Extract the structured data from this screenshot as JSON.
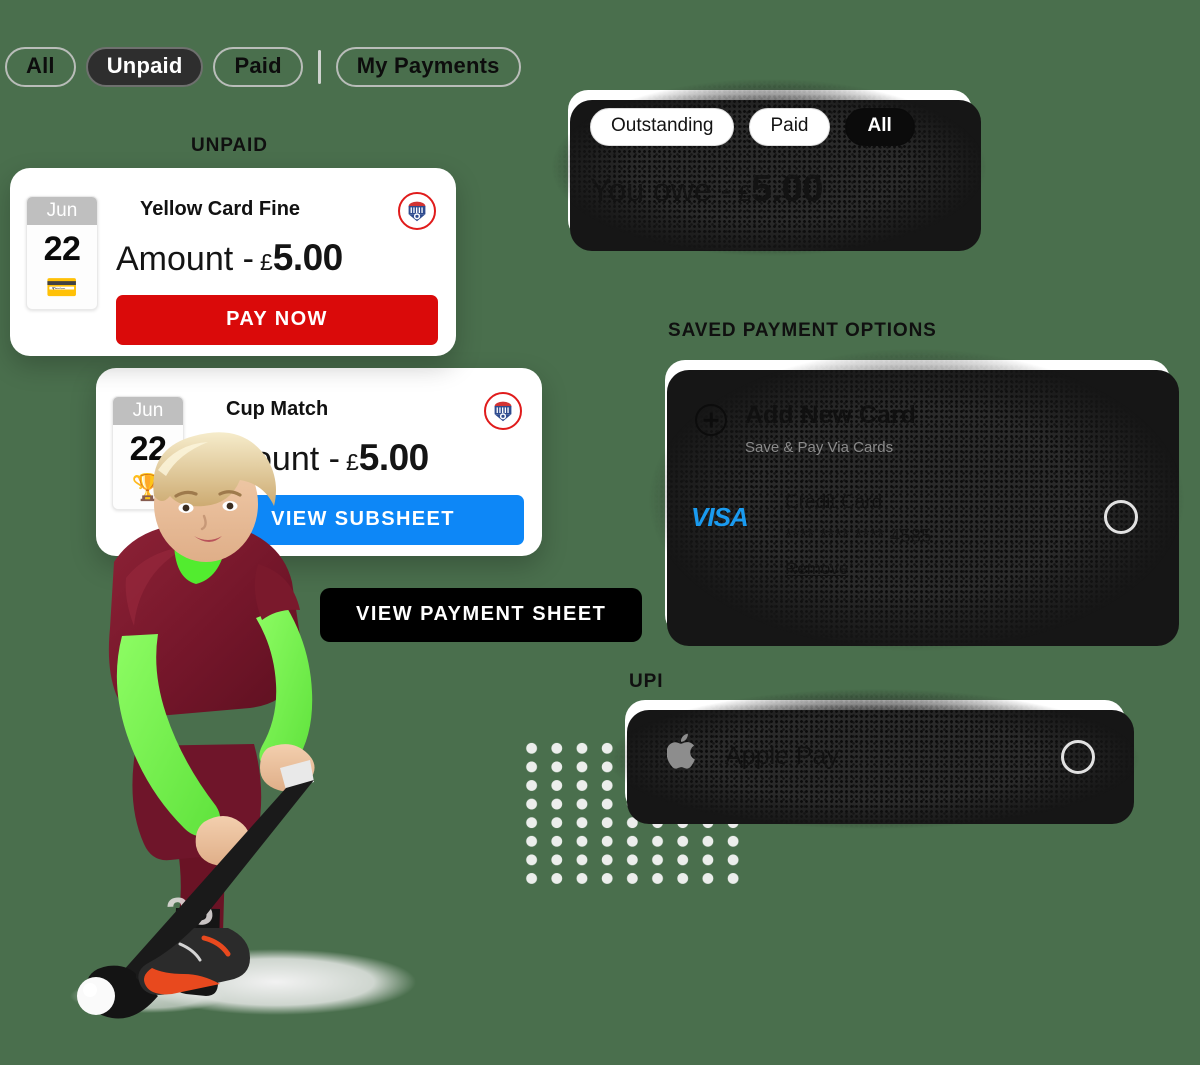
{
  "theme": {
    "background": "#4a6f4d",
    "accent_red": "#da0a0a",
    "accent_blue": "#0d87f7",
    "visa_blue": "#1a9bf0",
    "dark": "#0b0b0b"
  },
  "filter_bar": {
    "items": [
      {
        "label": "All",
        "active": false
      },
      {
        "label": "Unpaid",
        "active": true
      },
      {
        "label": "Paid",
        "active": false
      },
      {
        "label": "My Payments",
        "active": false
      }
    ]
  },
  "unpaid_section": {
    "heading": "UNPAID",
    "cards": [
      {
        "title": "Yellow Card Fine",
        "month": "Jun",
        "day": "22",
        "emoji": "credit-card-emoji",
        "emoji_glyph": "💳",
        "amount_label": "Amount -",
        "currency": "£",
        "amount": "5.00",
        "button_label": "PAY NOW",
        "button_color": "red",
        "badge": "club-crest"
      },
      {
        "title": "Cup Match",
        "month": "Jun",
        "day": "22",
        "emoji": "trophy-emoji",
        "emoji_glyph": "🏆",
        "amount_label": "Amount -",
        "currency": "£",
        "amount": "5.00",
        "button_label": "VIEW SUBSHEET",
        "button_color": "blue",
        "badge": "club-crest"
      }
    ]
  },
  "view_payment_sheet": {
    "label": "VIEW PAYMENT SHEET"
  },
  "you_owe_card": {
    "pills": [
      {
        "label": "Outstanding",
        "active": false
      },
      {
        "label": "Paid",
        "active": false
      },
      {
        "label": "All",
        "active": true
      }
    ],
    "owe_label": "You owe -",
    "currency": "£",
    "amount": "5.00"
  },
  "saved_payments": {
    "heading": "SAVED PAYMENT OPTIONS",
    "add_new_card": {
      "title": "Add New Card",
      "subtitle": "Save & Pay Via Cards",
      "icon": "plus-circle-icon"
    },
    "saved_card": {
      "brand": "VISA",
      "label": "Credit Card",
      "number": "**** **** **** 4585",
      "remove_label": "Remove",
      "selected": false
    }
  },
  "upi_section": {
    "heading": "UPI",
    "options": [
      {
        "label": "Apple Pay",
        "icon": "apple-icon",
        "icon_glyph": "",
        "selected": false
      }
    ]
  },
  "illustration": {
    "name": "field-hockey-player",
    "jersey_number": "25"
  }
}
